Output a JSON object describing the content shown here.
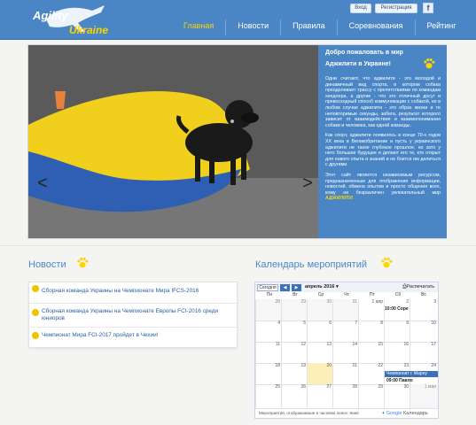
{
  "logo": {
    "line1": "Agility",
    "line2": "Ukraine"
  },
  "top_buttons": {
    "login": "Вход",
    "register": "Регистрация",
    "facebook": "f"
  },
  "nav": [
    {
      "label": "Главная",
      "active": true
    },
    {
      "label": "Новости",
      "active": false
    },
    {
      "label": "Правила",
      "active": false
    },
    {
      "label": "Соревнования",
      "active": false
    },
    {
      "label": "Рейтинг",
      "active": false
    }
  ],
  "slider": {
    "prev_arrow": "<",
    "next_arrow": ">",
    "welcome_line1": "Добро пожаловать в мир",
    "welcome_line2": "Аджилити в Украине!",
    "paragraphs": [
      "Одни считают, что аджилити - это молодой и динамичный вид спорта, в котором собака преодолевает трассу с препятствиями по командам хендлера, а другие - что это отличный досуг и превосходный способ коммуникации с собакой, но в любом случае аджилити - это образ жизни и те неповторимые секунды, забега, результат которого зависит от взаимодействия и взаимопонимания собаки и человека, как одной команды.",
      "Как спорт, аджилити появилось в конце 70-х годов XX века в Великобритании и пусть у украинского аджилити не такое глубокое прошлое, но зато у него большое будущее и делают его те, кто открыт для нового опыта и знаний и не боится им делиться с другими.",
      "Этот сайт является независимым ресурсом, предназначенным для отображения информации, новостей, обмена опытом и просто общения всех, кому не безразличен увлекательный мир"
    ],
    "last_word": "АДЖИЛИТИ"
  },
  "news": {
    "title": "Новости",
    "items": [
      "Сборная команда Украины на Чемпионате Мира IFCS-2016",
      "Сборная команда Украины на Чемпионате Европы FCI-2016 среди юниоров",
      "Чемпионат Мира FCI-2017 пройдет в Чехии!"
    ]
  },
  "calendar": {
    "title": "Календарь мероприятий",
    "today_button": "Сегодня",
    "prev": "◀",
    "next": "▶",
    "month": "апрель 2016",
    "month_dropdown": "▾",
    "print": "Распечатать",
    "weekdays": [
      "Пн",
      "Вт",
      "Ср",
      "Чт",
      "Пт",
      "Сб",
      "Вс"
    ],
    "weeks": [
      [
        "28",
        "29",
        "30",
        "31",
        "1 апр",
        "2",
        "3"
      ],
      [
        "4",
        "5",
        "6",
        "7",
        "8",
        "9",
        "10"
      ],
      [
        "11",
        "12",
        "13",
        "14",
        "15",
        "16",
        "17"
      ],
      [
        "18",
        "19",
        "20",
        "21",
        "22",
        "23",
        "24"
      ],
      [
        "25",
        "26",
        "27",
        "28",
        "29",
        "30",
        "1 мая"
      ]
    ],
    "events": {
      "e1": "10:00 Соре",
      "e2": "Чемпионат г. Марну",
      "e3": "09:00 Павло"
    },
    "footer": "Мероприятия, отображаемые в часовом поясе: Киев",
    "google_label": "Календарь",
    "google_word": "Google"
  },
  "colors": {
    "brand_blue": "#4a86c5",
    "accent_yellow": "#ffd200"
  }
}
